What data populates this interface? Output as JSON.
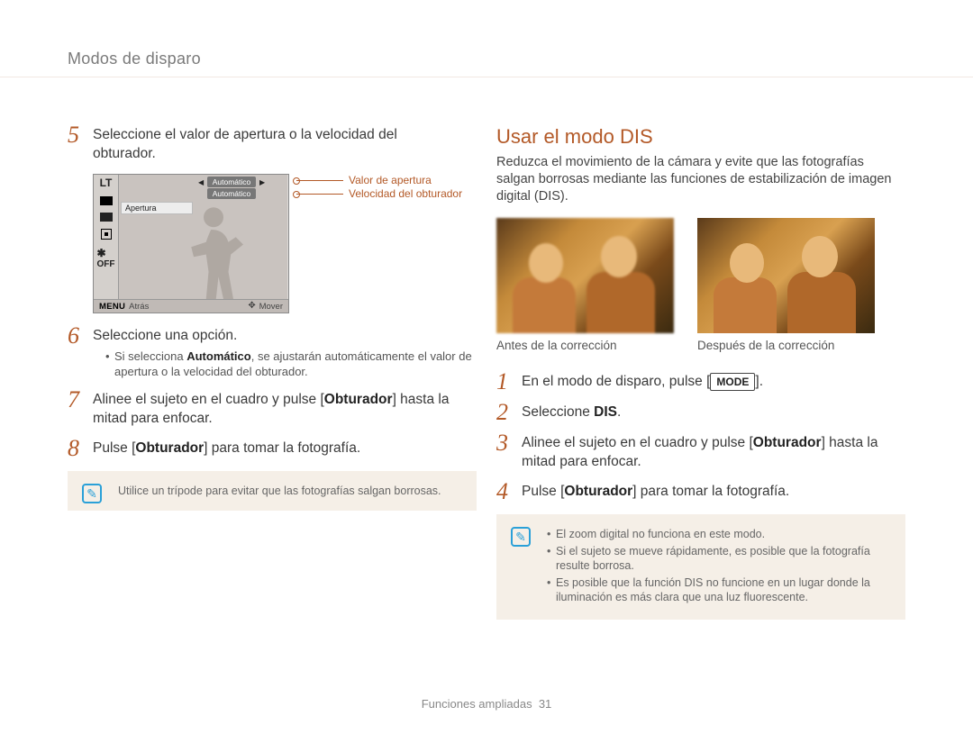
{
  "header": {
    "breadcrumb": "Modos de disparo"
  },
  "left": {
    "step5": {
      "num": "5",
      "text_a": "Seleccione el valor de apertura o la velocidad del",
      "text_b": "obturador."
    },
    "lcd": {
      "lt": "LT",
      "off": "OFF",
      "pill_a": "Automático",
      "pill_b": "Automático",
      "white_bar": "Apertura",
      "menu": "MENU",
      "atras": "Atrás",
      "mover": "Mover"
    },
    "legend": {
      "row1": "Valor de apertura",
      "row2": "Velocidad del obturador"
    },
    "step6": {
      "num": "6",
      "text": "Seleccione una opción.",
      "sub_a": "Si selecciona ",
      "sub_bold": "Automático",
      "sub_b": ", se ajustarán automáticamente el valor de apertura o la velocidad del obturador."
    },
    "step7": {
      "num": "7",
      "text_a": "Alinee el sujeto en el cuadro y pulse [",
      "bold": "Obturador",
      "text_b": "] hasta la mitad para enfocar."
    },
    "step8": {
      "num": "8",
      "text_a": "Pulse [",
      "bold": "Obturador",
      "text_b": "] para tomar la fotografía."
    },
    "note": {
      "text": "Utilice un trípode para evitar que las fotografías salgan borrosas."
    }
  },
  "right": {
    "title": "Usar el modo DIS",
    "lead": "Reduzca el movimiento de la cámara y evite que las fotografías salgan borrosas mediante las funciones de estabilización de imagen digital (DIS).",
    "captions": {
      "before": "Antes de la corrección",
      "after": "Después de la corrección"
    },
    "step1": {
      "num": "1",
      "text_a": "En el modo de disparo, pulse [",
      "mode": "MODE",
      "text_b": "]."
    },
    "step2": {
      "num": "2",
      "text_a": "Seleccione ",
      "bold": "DIS",
      "text_b": "."
    },
    "step3": {
      "num": "3",
      "text_a": "Alinee el sujeto en el cuadro y pulse [",
      "bold": "Obturador",
      "text_b": "] hasta la mitad para enfocar."
    },
    "step4": {
      "num": "4",
      "text_a": "Pulse [",
      "bold": "Obturador",
      "text_b": "] para tomar la fotografía."
    },
    "note": {
      "li1": "El zoom digital no funciona en este modo.",
      "li2": "Si el sujeto se mueve rápidamente, es posible que la fotografía resulte borrosa.",
      "li3": "Es posible que la función DIS no funcione en un lugar donde la iluminación es más clara que una luz fluorescente."
    }
  },
  "footer": {
    "section": "Funciones ampliadas",
    "page": "31"
  }
}
